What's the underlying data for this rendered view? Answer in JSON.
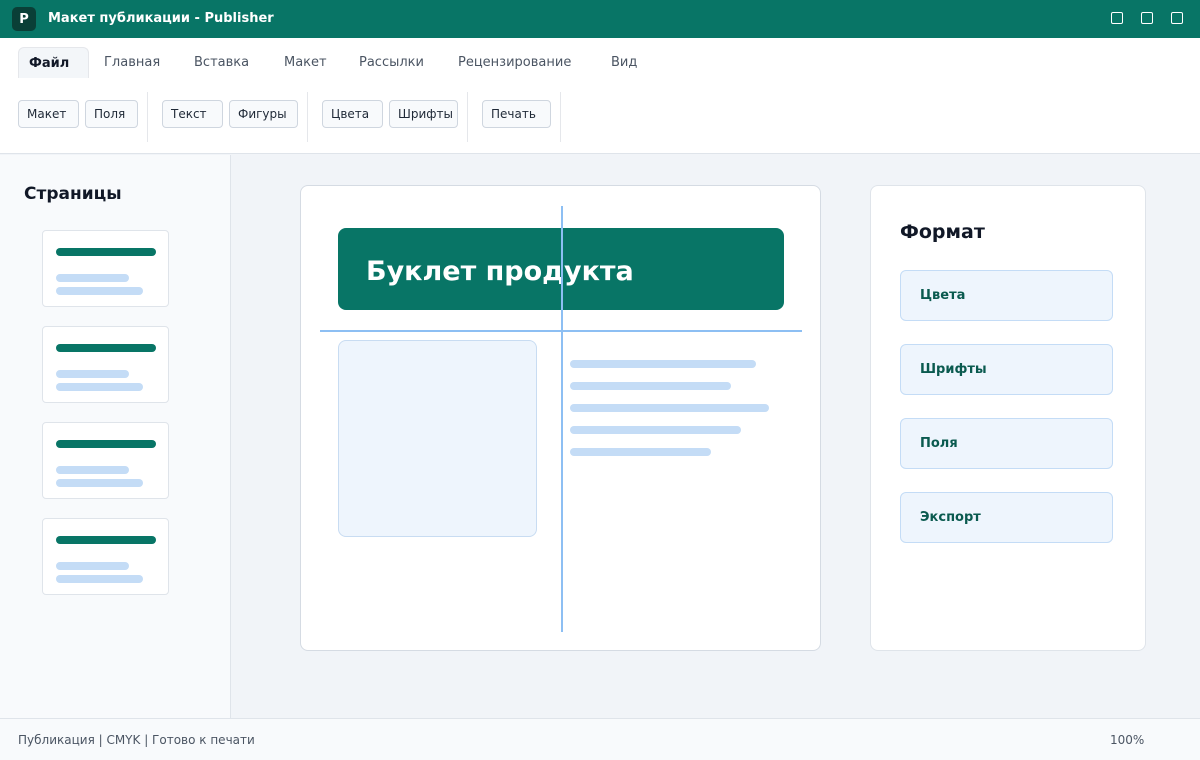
{
  "window": {
    "logo_letter": "P",
    "title": "Макет публикации - Publisher",
    "accent_color": "#087566"
  },
  "tabs": [
    {
      "label": "Файл",
      "active": true
    },
    {
      "label": "Главная"
    },
    {
      "label": "Вставка"
    },
    {
      "label": "Макет"
    },
    {
      "label": "Рассылки"
    },
    {
      "label": "Рецензирование"
    },
    {
      "label": "Вид"
    }
  ],
  "ribbon": {
    "buttons": [
      "Макет",
      "Поля",
      "Текст",
      "Фигуры",
      "Цвета",
      "Шрифты",
      "Печать"
    ]
  },
  "pages_panel": {
    "title": "Страницы",
    "page_count": 4
  },
  "document": {
    "heading": "Буклет продукта"
  },
  "format_panel": {
    "title": "Формат",
    "buttons": [
      "Цвета",
      "Шрифты",
      "Поля",
      "Экспорт"
    ]
  },
  "statusbar": {
    "text": "Публикация | CMYK | Готово к печати",
    "zoom": "100%"
  },
  "icons": {
    "minimize": "minimize-icon",
    "maximize": "maximize-icon",
    "close": "close-icon"
  }
}
